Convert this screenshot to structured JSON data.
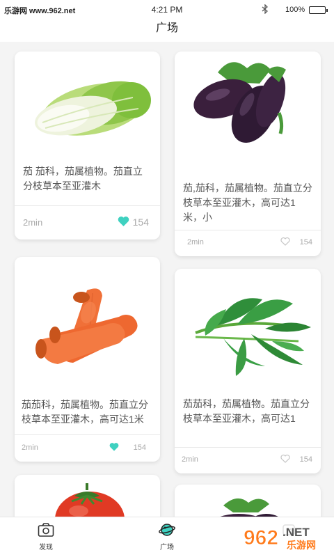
{
  "status_bar": {
    "left_label": "乐游网 www.962.net",
    "time": "4:21 PM",
    "battery": "100%"
  },
  "header": {
    "title": "广场"
  },
  "cards": [
    {
      "image": "napa-cabbage",
      "description": "茄  茄科，茄属植物。茄直立分枝草本至亚灌木",
      "time": "2min",
      "likes": "154",
      "liked": true
    },
    {
      "image": "eggplant",
      "description": "茄,茄科，茄属植物。茄直立分枝草本至亚灌木，高可达1米，小",
      "time": "2min",
      "likes": "154",
      "liked": false
    },
    {
      "image": "carrot",
      "description": "茄茄科，茄属植物。茄直立分枝草本至亚灌木，高可达1米",
      "time": "2min",
      "likes": "154",
      "liked": true
    },
    {
      "image": "water-spinach",
      "description": "茄茄科，茄属植物。茄直立分枝草本至亚灌木，高可达1",
      "time": "2min",
      "likes": "154",
      "liked": false
    },
    {
      "image": "tomato"
    },
    {
      "image": "eggplant"
    }
  ],
  "tabs": [
    {
      "label": "发现",
      "icon": "camera-icon"
    },
    {
      "label": "广场",
      "icon": "planet-icon",
      "active": true
    },
    {
      "label": "",
      "icon": "profile-icon"
    }
  ],
  "watermark": {
    "brand": "962",
    "suffix": ".NET",
    "subtitle": "乐游网"
  },
  "colors": {
    "accent": "#3fd1c0",
    "card_bg": "#ffffff",
    "page_bg": "#f4f4f4"
  }
}
